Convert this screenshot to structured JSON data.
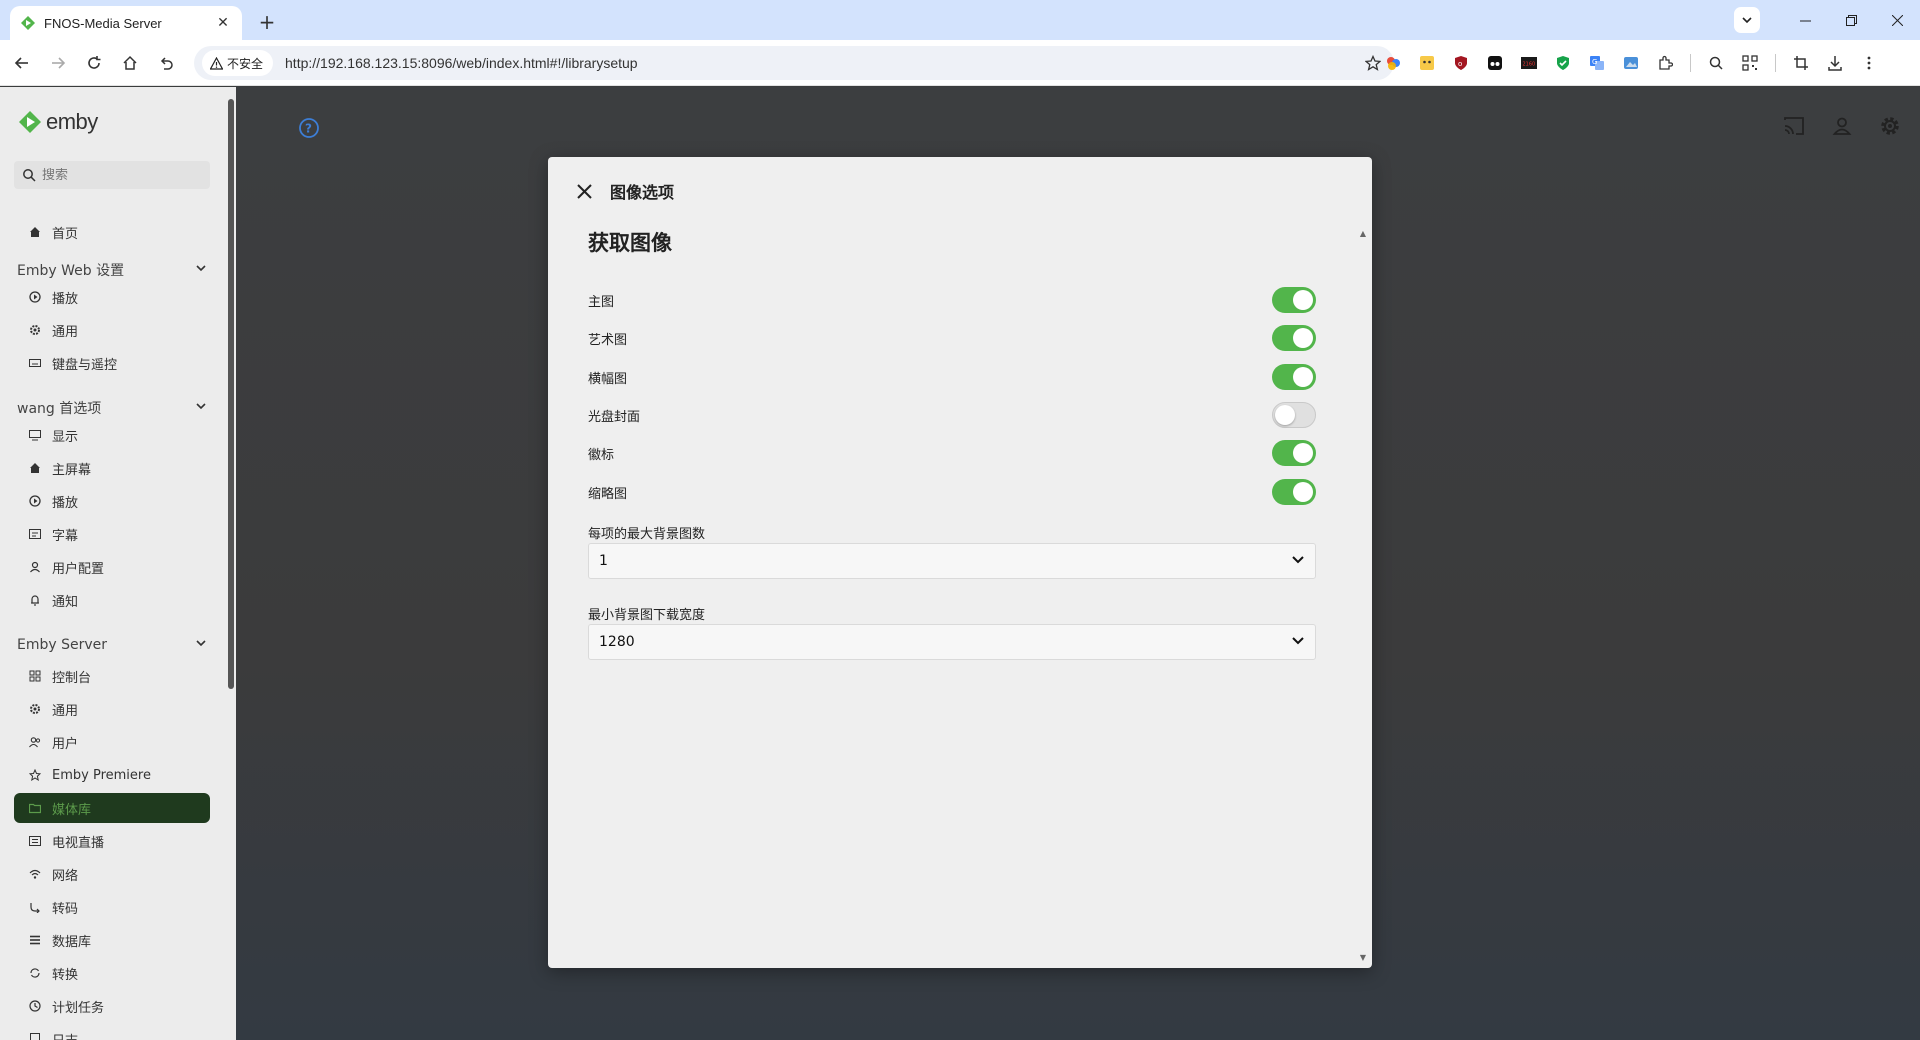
{
  "browser": {
    "tab_title": "FNOS-Media Server",
    "secure_label": "不安全",
    "url": "http://192.168.123.15:8096/web/index.html#!/librarysetup"
  },
  "sidebar": {
    "logo_text": "emby",
    "search_placeholder": "搜索",
    "home": "首页",
    "sections": [
      {
        "title": "Emby Web 设置",
        "items": [
          "播放",
          "通用",
          "键盘与遥控"
        ]
      },
      {
        "title": "wang 首选项",
        "items": [
          "显示",
          "主屏幕",
          "播放",
          "字幕",
          "用户配置",
          "通知"
        ]
      },
      {
        "title": "Emby Server",
        "items": [
          "控制台",
          "通用",
          "用户",
          "Emby Premiere",
          "媒体库",
          "电视直播",
          "网络",
          "转码",
          "数据库",
          "转换",
          "计划任务",
          "日志"
        ]
      }
    ],
    "active_item": "媒体库"
  },
  "dialog": {
    "title": "图像选项",
    "section_title": "获取图像",
    "options": [
      {
        "label": "主图",
        "enabled": true
      },
      {
        "label": "艺术图",
        "enabled": true
      },
      {
        "label": "横幅图",
        "enabled": true
      },
      {
        "label": "光盘封面",
        "enabled": false
      },
      {
        "label": "徽标",
        "enabled": true
      },
      {
        "label": "缩略图",
        "enabled": true
      }
    ],
    "max_backdrops_label": "每项的最大背景图数",
    "max_backdrops_value": "1",
    "min_backdrop_width_label": "最小背景图下载宽度",
    "min_backdrop_width_value": "1280"
  },
  "colors": {
    "toggle_on": "#52b54b",
    "active_nav_bg": "#1f3a1e",
    "active_nav_text": "#5c9b4b",
    "tabbar_bg": "#d3e3fd"
  }
}
